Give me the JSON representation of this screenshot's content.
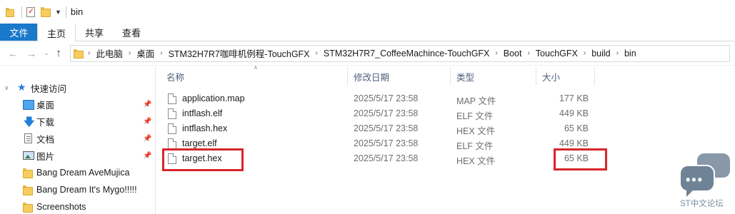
{
  "window": {
    "title": "bin"
  },
  "ribbon": {
    "tabs": [
      "文件",
      "主页",
      "共享",
      "查看"
    ]
  },
  "nav": {
    "back": "←",
    "forward": "→",
    "recent": "⌄",
    "up": "↑",
    "breadcrumb": [
      "此电脑",
      "桌面",
      "STM32H7R7咖啡机例程-TouchGFX",
      "STM32H7R7_CoffeeMachince-TouchGFX",
      "Boot",
      "TouchGFX",
      "build",
      "bin"
    ],
    "separator": "›"
  },
  "sidebar": {
    "quick_access": "快速访问",
    "items": [
      {
        "label": "桌面",
        "icon": "desktop-icon",
        "pinned": true
      },
      {
        "label": "下载",
        "icon": "download-icon",
        "pinned": true
      },
      {
        "label": "文档",
        "icon": "document-icon",
        "pinned": true
      },
      {
        "label": "图片",
        "icon": "picture-icon",
        "pinned": true
      },
      {
        "label": "Bang Dream AveMujica",
        "icon": "folder-icon",
        "pinned": false
      },
      {
        "label": "Bang Dream It's Mygo!!!!!",
        "icon": "folder-icon",
        "pinned": false
      },
      {
        "label": "Screenshots",
        "icon": "folder-icon",
        "pinned": false
      }
    ]
  },
  "columns": {
    "name": "名称",
    "modified": "修改日期",
    "type": "类型",
    "size": "大小"
  },
  "files": [
    {
      "name": "application.map",
      "modified": "2025/5/17 23:58",
      "type": "MAP 文件",
      "size": "177 KB",
      "highlighted": false
    },
    {
      "name": "intflash.elf",
      "modified": "2025/5/17 23:58",
      "type": "ELF 文件",
      "size": "449 KB",
      "highlighted": false
    },
    {
      "name": "intflash.hex",
      "modified": "2025/5/17 23:58",
      "type": "HEX 文件",
      "size": "65 KB",
      "highlighted": false
    },
    {
      "name": "target.elf",
      "modified": "2025/5/17 23:58",
      "type": "ELF 文件",
      "size": "449 KB",
      "highlighted": false
    },
    {
      "name": "target.hex",
      "modified": "2025/5/17 23:58",
      "type": "HEX 文件",
      "size": "65 KB",
      "highlighted": true
    }
  ],
  "highlight_color": "#d7262a",
  "accent_color": "#1979ca",
  "watermark": {
    "text": "ST中文论坛",
    "icon": "chat-bubbles-icon"
  }
}
